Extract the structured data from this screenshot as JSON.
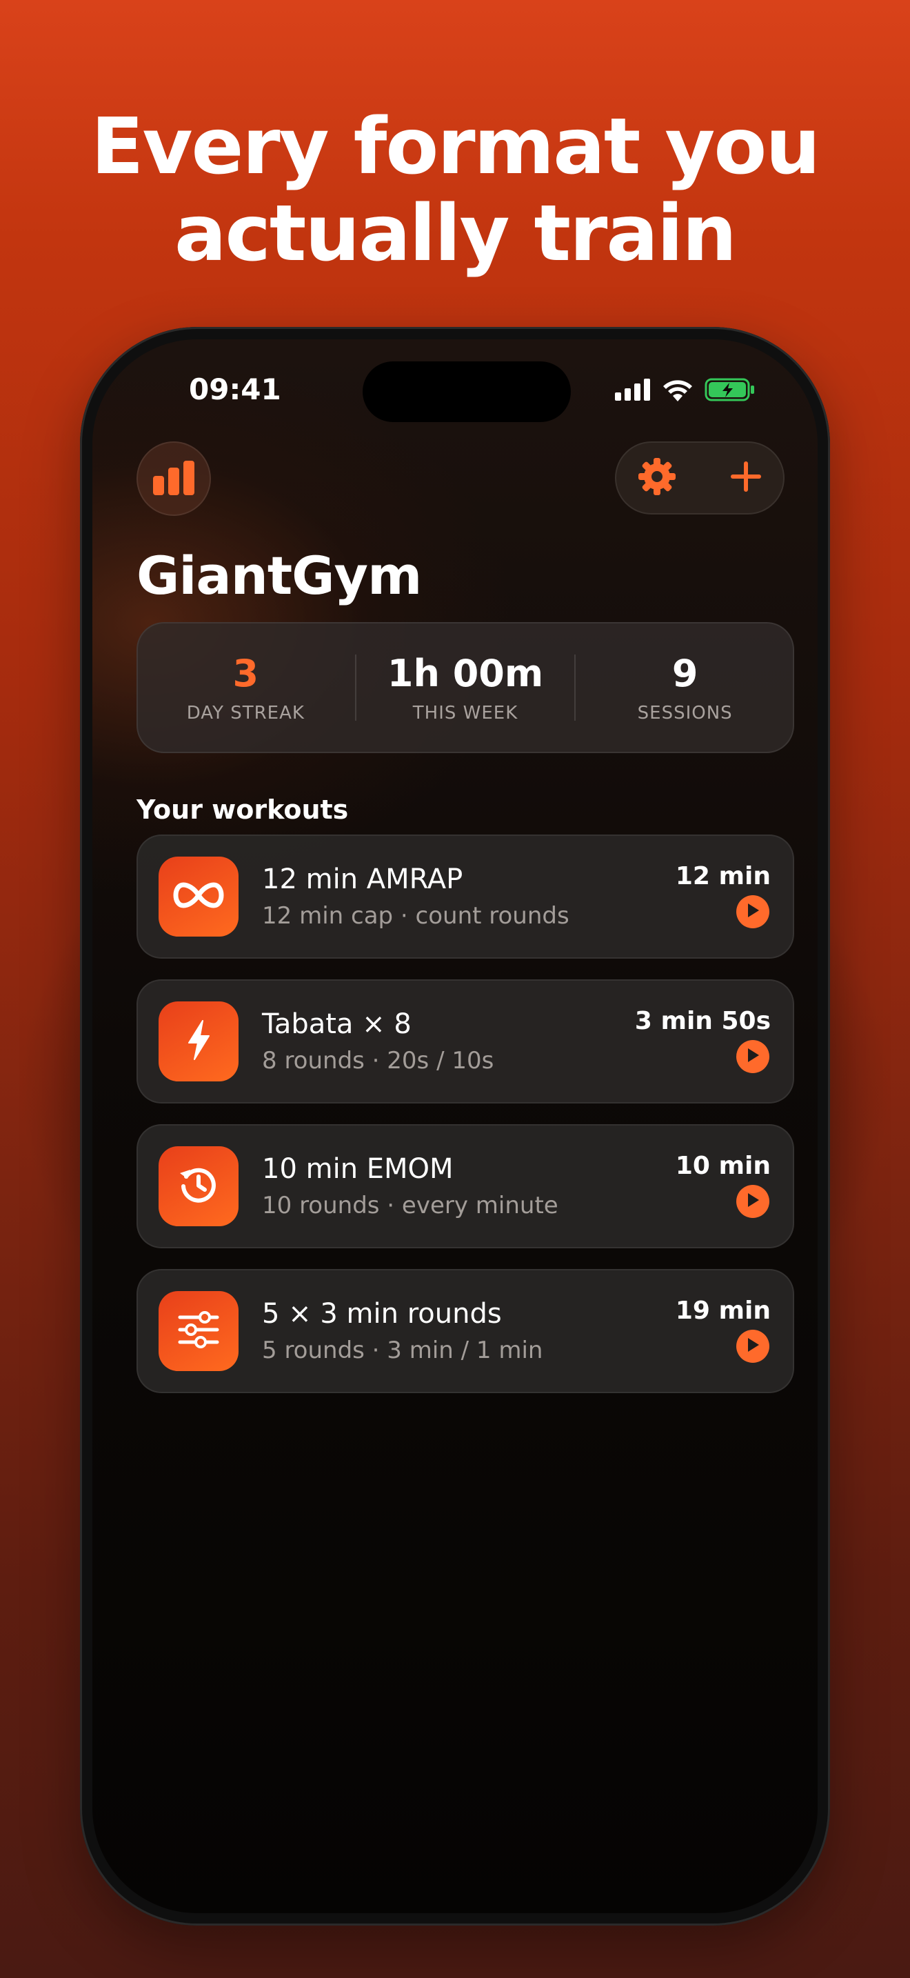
{
  "headline": {
    "line1": "Every format you",
    "line2": "actually train"
  },
  "status_bar": {
    "time": "09:41"
  },
  "app": {
    "title": "GiantGym"
  },
  "toolbar": {
    "stats_icon": "bar-chart-icon",
    "settings_icon": "gear-icon",
    "add_icon": "plus-icon"
  },
  "stats": [
    {
      "value": "3",
      "label": "DAY STREAK"
    },
    {
      "value": "1h 00m",
      "label": "THIS WEEK"
    },
    {
      "value": "9",
      "label": "SESSIONS"
    }
  ],
  "section": {
    "title": "Your workouts"
  },
  "workouts": [
    {
      "name": "12 min AMRAP",
      "subtitle": "12 min cap · count rounds",
      "duration": "12 min",
      "icon": "infinity-icon"
    },
    {
      "name": "Tabata × 8",
      "subtitle": "8 rounds · 20s / 10s",
      "duration": "3 min 50s",
      "icon": "lightning-icon"
    },
    {
      "name": "10 min EMOM",
      "subtitle": "10 rounds · every minute",
      "duration": "10 min",
      "icon": "history-clock-icon"
    },
    {
      "name": "5 × 3 min rounds",
      "subtitle": "5 rounds · 3 min / 1 min",
      "duration": "19 min",
      "icon": "sliders-icon"
    }
  ],
  "colors": {
    "accent": "#ff6a2b",
    "background_top": "#d9421a",
    "battery": "#34c759"
  }
}
